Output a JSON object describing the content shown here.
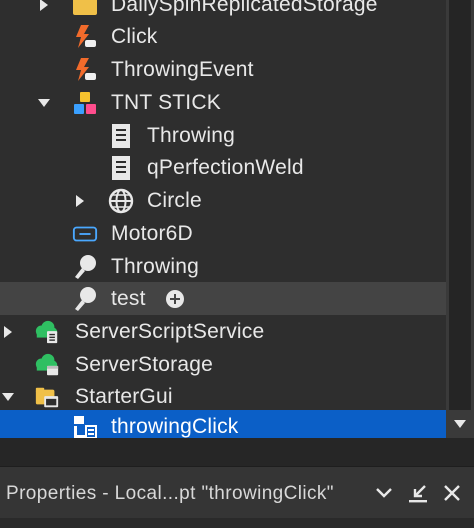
{
  "explorer": {
    "items": [
      {
        "label": "DailySpinReplicatedStorage",
        "icon": "folder-icon"
      },
      {
        "label": "Click",
        "icon": "remote-event-icon"
      },
      {
        "label": "ThrowingEvent",
        "icon": "remote-event-icon"
      },
      {
        "label": "TNT STICK",
        "icon": "tool-icon"
      },
      {
        "label": "Throwing",
        "icon": "script-icon"
      },
      {
        "label": "qPerfectionWeld",
        "icon": "script-icon"
      },
      {
        "label": "Circle",
        "icon": "globe-icon"
      },
      {
        "label": "Motor6D",
        "icon": "motor6d-icon"
      },
      {
        "label": "Throwing",
        "icon": "animation-icon"
      },
      {
        "label": "test",
        "icon": "animation-icon"
      },
      {
        "label": "ServerScriptService",
        "icon": "server-script-service-icon"
      },
      {
        "label": "ServerStorage",
        "icon": "server-storage-icon"
      },
      {
        "label": "StarterGui",
        "icon": "starter-gui-icon"
      },
      {
        "label": "throwingClick",
        "icon": "screen-gui-icon"
      }
    ]
  },
  "properties": {
    "title": "Properties - Local...pt \"throwingClick\""
  },
  "colors": {
    "selection": "#0b5fc7",
    "hover": "#444444",
    "background": "#2e2e2e",
    "event_orange": "#f26b2b",
    "green": "#2fbf62"
  }
}
